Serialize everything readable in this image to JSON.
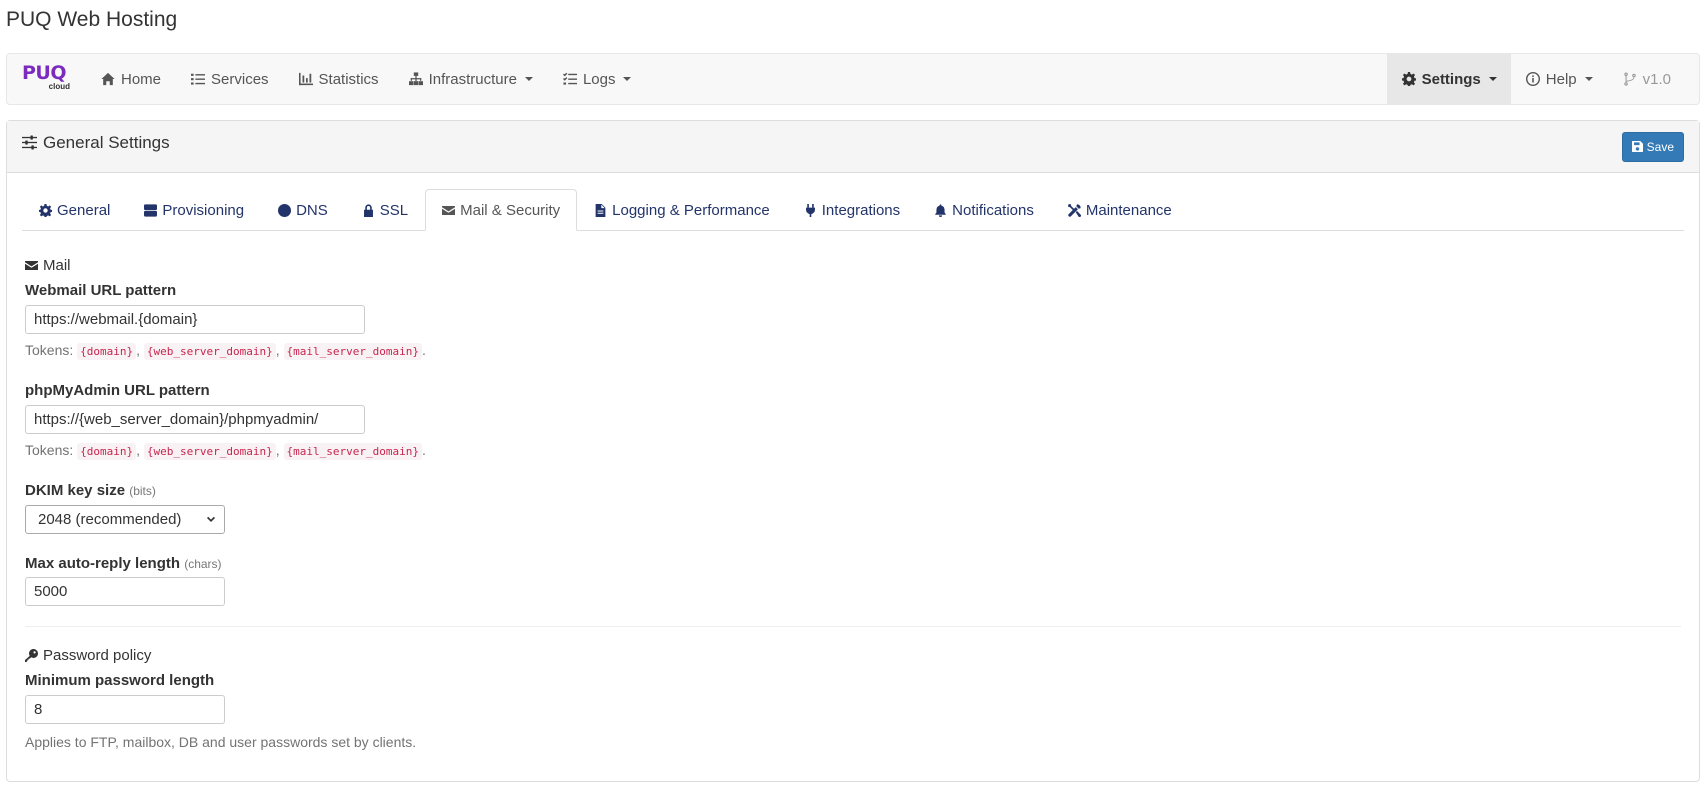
{
  "app": {
    "title": "PUQ Web Hosting"
  },
  "brand": {
    "main": "PUQ",
    "sub": "cloud"
  },
  "nav": {
    "left": [
      {
        "label": "Home",
        "icon": "home-icon"
      },
      {
        "label": "Services",
        "icon": "list-icon"
      },
      {
        "label": "Statistics",
        "icon": "chart-icon"
      },
      {
        "label": "Infrastructure",
        "icon": "sitemap-icon",
        "dropdown": true
      },
      {
        "label": "Logs",
        "icon": "list-check-icon",
        "dropdown": true
      }
    ],
    "right": [
      {
        "label": "Settings",
        "icon": "gear-icon",
        "dropdown": true,
        "active": true
      },
      {
        "label": "Help",
        "icon": "info-icon",
        "dropdown": true
      },
      {
        "label": "v1.0",
        "icon": "branch-icon"
      }
    ]
  },
  "panel": {
    "title": "General Settings",
    "save_label": "Save"
  },
  "tabs": [
    {
      "label": "General",
      "icon": "gear-icon"
    },
    {
      "label": "Provisioning",
      "icon": "server-icon"
    },
    {
      "label": "DNS",
      "icon": "globe-icon"
    },
    {
      "label": "SSL",
      "icon": "lock-icon"
    },
    {
      "label": "Mail & Security",
      "icon": "envelope-icon",
      "active": true
    },
    {
      "label": "Logging & Performance",
      "icon": "file-icon"
    },
    {
      "label": "Integrations",
      "icon": "plug-icon"
    },
    {
      "label": "Notifications",
      "icon": "bell-icon"
    },
    {
      "label": "Maintenance",
      "icon": "tools-icon"
    }
  ],
  "mail": {
    "heading": "Mail",
    "webmail": {
      "label": "Webmail URL pattern",
      "value": "https://webmail.{domain}",
      "tokens_prefix": "Tokens:",
      "tokens": [
        "{domain}",
        "{web_server_domain}",
        "{mail_server_domain}"
      ]
    },
    "phpmyadmin": {
      "label": "phpMyAdmin URL pattern",
      "value": "https://{web_server_domain}/phpmyadmin/",
      "tokens_prefix": "Tokens:",
      "tokens": [
        "{domain}",
        "{web_server_domain}",
        "{mail_server_domain}"
      ]
    },
    "dkim": {
      "label": "DKIM key size",
      "unit": "(bits)",
      "value": "2048 (recommended)"
    },
    "autoreply": {
      "label": "Max auto-reply length",
      "unit": "(chars)",
      "value": "5000"
    }
  },
  "password": {
    "heading": "Password policy",
    "min_length": {
      "label": "Minimum password length",
      "value": "8",
      "help": "Applies to FTP, mailbox, DB and user passwords set by clients."
    }
  }
}
